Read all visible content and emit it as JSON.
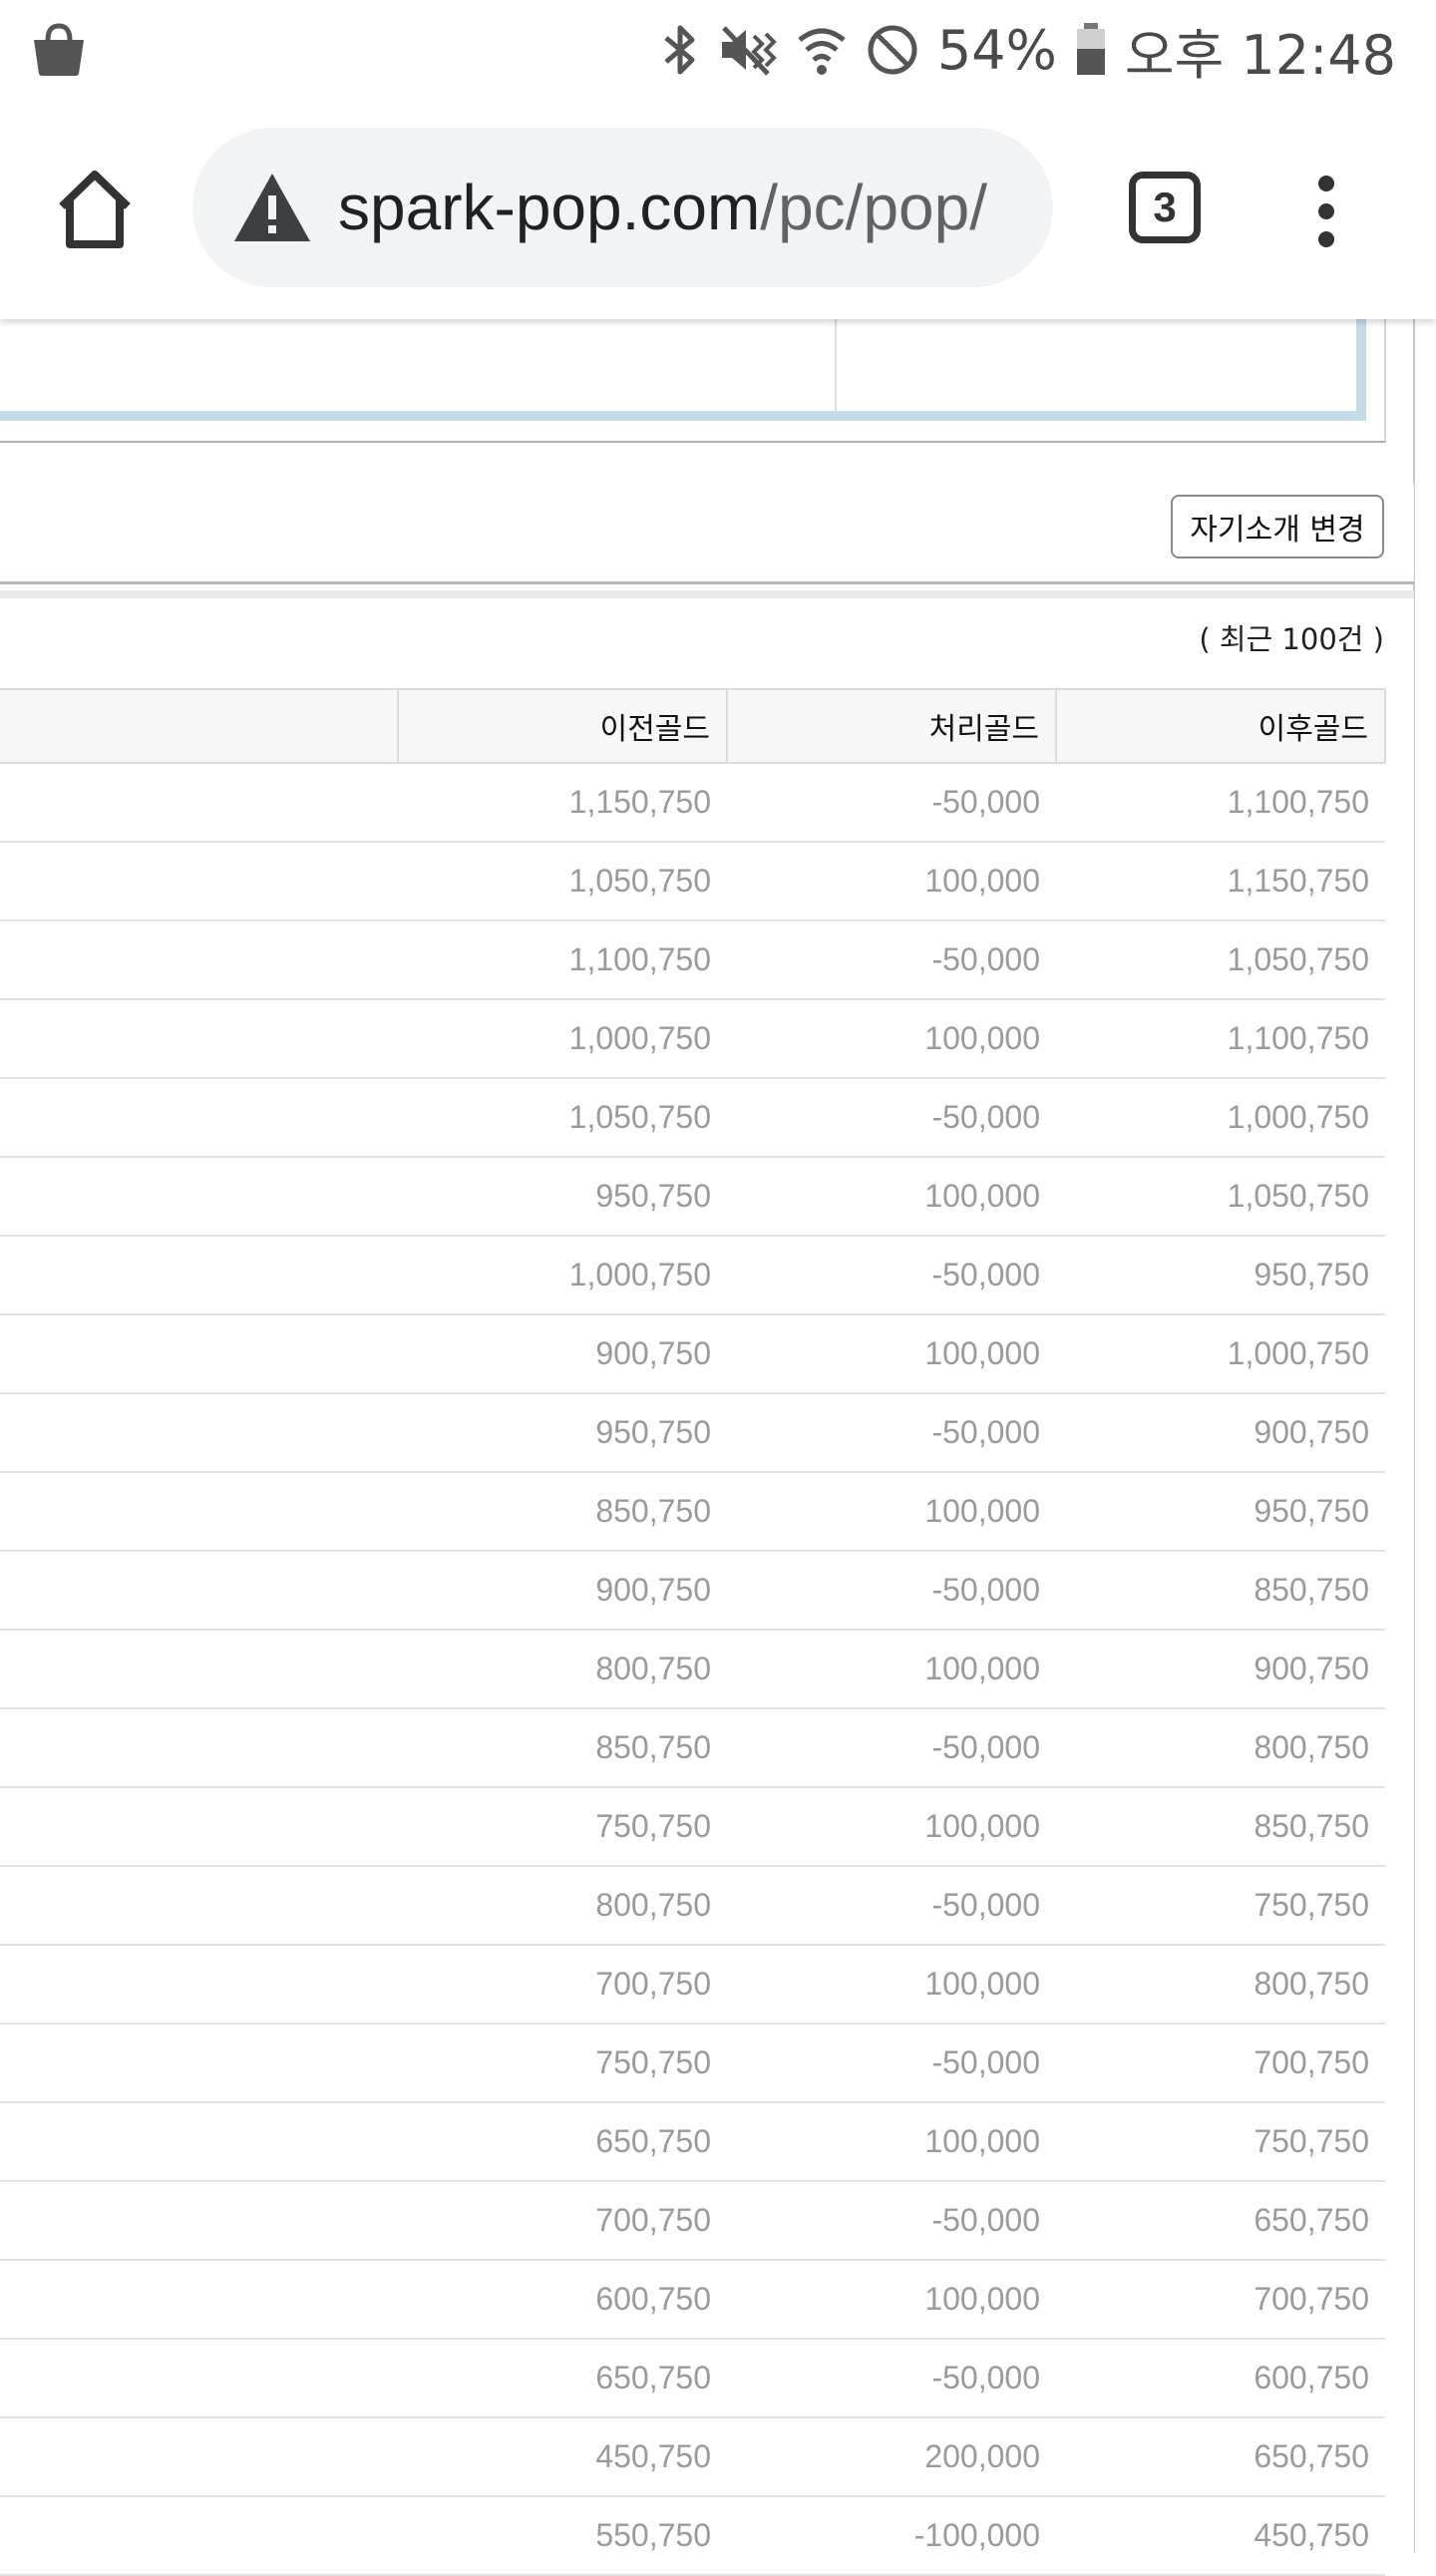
{
  "status_bar": {
    "battery": "54%",
    "time": "오후 12:48",
    "icons": [
      "shopping-bag-icon",
      "bluetooth-icon",
      "vibrate-mute-icon",
      "wifi-icon",
      "do-not-disturb-icon",
      "battery-icon"
    ]
  },
  "browser": {
    "url_host": "spark-pop.com",
    "url_path": "/pc/pop/",
    "tab_count": "3",
    "icons": [
      "home-icon",
      "warning-icon",
      "tabs-icon",
      "more-vert-icon"
    ]
  },
  "profile": {
    "intro_button_label": "자기소개 변경"
  },
  "gold_history": {
    "recent_note": "( 최근 100건 )",
    "columns": [
      "",
      "이전골드",
      "처리골드",
      "이후골드"
    ],
    "rows": [
      [
        "",
        "1,150,750",
        "-50,000",
        "1,100,750"
      ],
      [
        "",
        "1,050,750",
        "100,000",
        "1,150,750"
      ],
      [
        "",
        "1,100,750",
        "-50,000",
        "1,050,750"
      ],
      [
        "",
        "1,000,750",
        "100,000",
        "1,100,750"
      ],
      [
        "",
        "1,050,750",
        "-50,000",
        "1,000,750"
      ],
      [
        "",
        "950,750",
        "100,000",
        "1,050,750"
      ],
      [
        "",
        "1,000,750",
        "-50,000",
        "950,750"
      ],
      [
        "",
        "900,750",
        "100,000",
        "1,000,750"
      ],
      [
        "",
        "950,750",
        "-50,000",
        "900,750"
      ],
      [
        "",
        "850,750",
        "100,000",
        "950,750"
      ],
      [
        "",
        "900,750",
        "-50,000",
        "850,750"
      ],
      [
        "",
        "800,750",
        "100,000",
        "900,750"
      ],
      [
        "",
        "850,750",
        "-50,000",
        "800,750"
      ],
      [
        "",
        "750,750",
        "100,000",
        "850,750"
      ],
      [
        "",
        "800,750",
        "-50,000",
        "750,750"
      ],
      [
        "",
        "700,750",
        "100,000",
        "800,750"
      ],
      [
        "",
        "750,750",
        "-50,000",
        "700,750"
      ],
      [
        "",
        "650,750",
        "100,000",
        "750,750"
      ],
      [
        "",
        "700,750",
        "-50,000",
        "650,750"
      ],
      [
        "",
        "600,750",
        "100,000",
        "700,750"
      ],
      [
        "",
        "650,750",
        "-50,000",
        "600,750"
      ],
      [
        "",
        "450,750",
        "200,000",
        "650,750"
      ],
      [
        "",
        "550,750",
        "-100,000",
        "450,750"
      ]
    ]
  }
}
